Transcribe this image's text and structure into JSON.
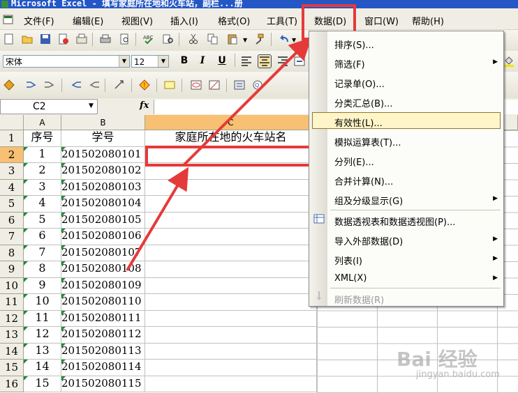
{
  "title_bar": {
    "text": "Microsoft Excel - 填写家庭所在地和火车站，副栏...册"
  },
  "menu": {
    "items": [
      "文件(F)",
      "编辑(E)",
      "视图(V)",
      "插入(I)",
      "格式(O)",
      "工具(T)",
      "数据(D)",
      "窗口(W)",
      "帮助(H)"
    ]
  },
  "font_toolbar": {
    "font_name": "宋体",
    "font_size": "12",
    "bold": "B",
    "italic": "I",
    "underline": "U"
  },
  "formula_bar": {
    "name_box": "C2",
    "fx": "fx"
  },
  "sheet": {
    "columns": [
      "A",
      "B",
      "C"
    ],
    "header_row": {
      "a": "序号",
      "b": "学号",
      "c": "家庭所在地的火车站名"
    },
    "rows": [
      {
        "n": "1",
        "a": "",
        "b": "",
        "c": ""
      },
      {
        "n": "2",
        "a": "1",
        "b": "201502080101",
        "c": ""
      },
      {
        "n": "3",
        "a": "2",
        "b": "201502080102",
        "c": ""
      },
      {
        "n": "4",
        "a": "3",
        "b": "201502080103",
        "c": ""
      },
      {
        "n": "5",
        "a": "4",
        "b": "201502080104",
        "c": ""
      },
      {
        "n": "6",
        "a": "5",
        "b": "201502080105",
        "c": ""
      },
      {
        "n": "7",
        "a": "6",
        "b": "201502080106",
        "c": ""
      },
      {
        "n": "8",
        "a": "7",
        "b": "201502080107",
        "c": ""
      },
      {
        "n": "9",
        "a": "8",
        "b": "201502080108",
        "c": ""
      },
      {
        "n": "10",
        "a": "9",
        "b": "201502080109",
        "c": ""
      },
      {
        "n": "11",
        "a": "10",
        "b": "201502080110",
        "c": ""
      },
      {
        "n": "12",
        "a": "11",
        "b": "201502080111",
        "c": ""
      },
      {
        "n": "13",
        "a": "12",
        "b": "201502080112",
        "c": ""
      },
      {
        "n": "14",
        "a": "13",
        "b": "201502080113",
        "c": ""
      },
      {
        "n": "15",
        "a": "14",
        "b": "201502080114",
        "c": ""
      },
      {
        "n": "16",
        "a": "15",
        "b": "201502080115",
        "c": ""
      }
    ]
  },
  "data_menu": {
    "items": [
      {
        "label": "排序(S)...",
        "submenu": false,
        "disabled": false
      },
      {
        "label": "筛选(F)",
        "submenu": true,
        "disabled": false
      },
      {
        "label": "记录单(O)...",
        "submenu": false,
        "disabled": false
      },
      {
        "label": "分类汇总(B)...",
        "submenu": false,
        "disabled": false
      },
      {
        "label": "有效性(L)...",
        "submenu": false,
        "disabled": false,
        "highlighted": true
      },
      {
        "label": "模拟运算表(T)...",
        "submenu": false,
        "disabled": false
      },
      {
        "label": "分列(E)...",
        "submenu": false,
        "disabled": false
      },
      {
        "label": "合并计算(N)...",
        "submenu": false,
        "disabled": false
      },
      {
        "label": "组及分级显示(G)",
        "submenu": true,
        "disabled": false
      },
      {
        "label": "数据透视表和数据透视图(P)...",
        "submenu": false,
        "disabled": false
      },
      {
        "label": "导入外部数据(D)",
        "submenu": true,
        "disabled": false
      },
      {
        "label": "列表(I)",
        "submenu": true,
        "disabled": false
      },
      {
        "label": "XML(X)",
        "submenu": true,
        "disabled": false
      },
      {
        "label": "刷新数据(R)",
        "submenu": false,
        "disabled": true
      }
    ]
  },
  "watermark": {
    "brand": "Bai  经验",
    "url": "jingyan.baidu.com"
  },
  "colors": {
    "annotation_red": "#e53a3a",
    "menu_highlight": "#fff5c8",
    "selected_header": "#f7c073",
    "comment_triangle": "#1e8a33"
  }
}
